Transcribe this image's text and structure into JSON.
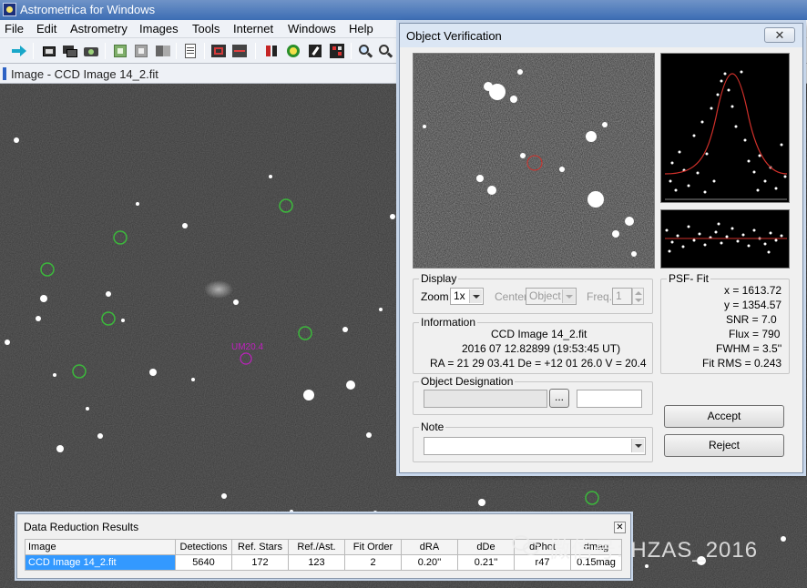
{
  "app": {
    "title": "Astrometrica for Windows"
  },
  "menu": [
    "File",
    "Edit",
    "Astrometry",
    "Images",
    "Tools",
    "Internet",
    "Windows",
    "Help"
  ],
  "toolbar": {
    "icons": [
      "arrow-right-icon",
      "open-image-icon",
      "open-images-icon",
      "camera-icon",
      "green-square-icon",
      "gray-square-icon",
      "blink-icon",
      "document-icon",
      "red-cross-icon",
      "delete-icon",
      "pointer-icon",
      "circle-select-icon",
      "pen-icon",
      "grid-icon",
      "zoom-in-icon",
      "zoom-out-icon"
    ]
  },
  "image_window": {
    "caption": "Image - CCD Image 14_2.fit",
    "object_label": "UM20.4"
  },
  "dialog": {
    "title": "Object Verification",
    "close_label": "✕",
    "display": {
      "group": "Display",
      "zoom_label": "Zoom",
      "zoom_value": "1x",
      "center_label": "Center",
      "center_value": "Object",
      "freq_label": "Freq.",
      "freq_value": "1"
    },
    "psf": {
      "group": "PSF- Fit",
      "x": "x = 1613.72",
      "y": "y = 1354.57",
      "snr": "SNR = 7.0",
      "flux": "Flux = 790",
      "fwhm": "FWHM = 3.5''",
      "rms": "Fit RMS = 0.243"
    },
    "information": {
      "group": "Information",
      "line1": "CCD Image 14_2.fit",
      "line2": "2016 07 12.82899 (19:53:45 UT)",
      "line3": "RA = 21 29 03.41    De = +12 01 26.0    V = 20.4"
    },
    "designation": {
      "group": "Object Designation",
      "browse_label": "..."
    },
    "note": {
      "group": "Note"
    },
    "accept_label": "Accept",
    "reject_label": "Reject"
  },
  "results": {
    "title": "Data Reduction Results",
    "close_label": "✕",
    "columns": [
      "Image",
      "Detections",
      "Ref. Stars",
      "Ref./Ast.",
      "Fit Order",
      "dRA",
      "dDe",
      "dPhot",
      "dmag"
    ],
    "rows": [
      [
        "CCD Image 14_2.fit",
        "5640",
        "172",
        "123",
        "2",
        "0.20''",
        "0.21''",
        "r47",
        "0.15mag"
      ]
    ]
  },
  "watermark": {
    "text": "微信号: HZAS_2016"
  }
}
